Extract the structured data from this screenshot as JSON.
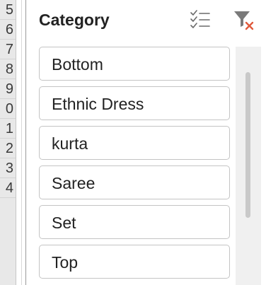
{
  "row_headers": [
    "5",
    "6",
    "7",
    "8",
    "9",
    "0",
    "1",
    "2",
    "3",
    "4"
  ],
  "slicer": {
    "title": "Category",
    "items": [
      {
        "label": "Bottom"
      },
      {
        "label": "Ethnic Dress"
      },
      {
        "label": "kurta"
      },
      {
        "label": "Saree"
      },
      {
        "label": "Set"
      },
      {
        "label": "Top"
      }
    ],
    "icons": {
      "multi_select": "multi-select-icon",
      "clear_filter": "clear-filter-icon"
    },
    "colors": {
      "border": "#9a9a9a",
      "item_border": "#c4c4c4",
      "clear_x": "#e05a3c",
      "scroll_thumb": "#c9c9c9"
    }
  }
}
